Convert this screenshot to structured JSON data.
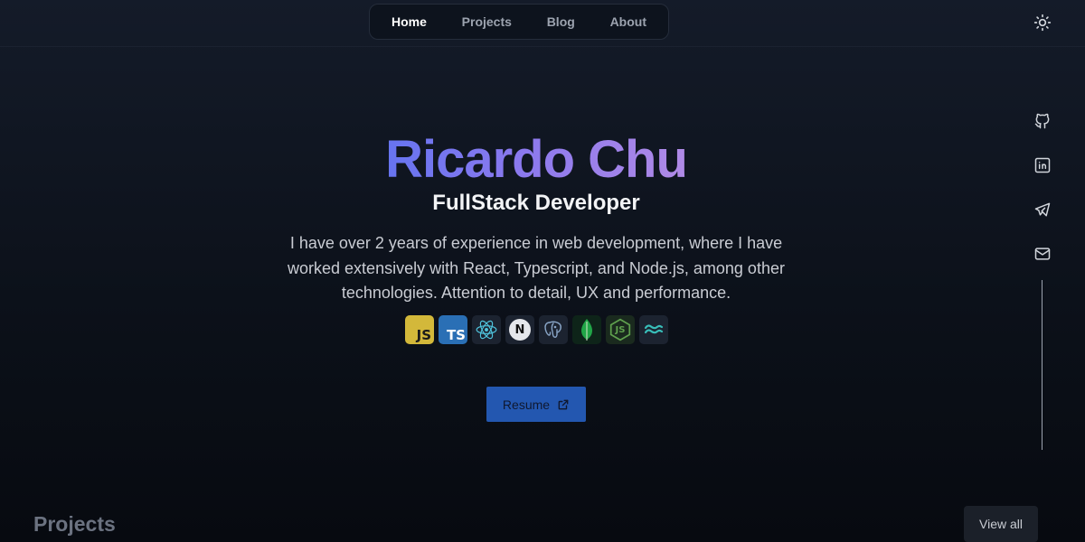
{
  "header": {
    "nav": [
      {
        "label": "Home",
        "active": true
      },
      {
        "label": "Projects",
        "active": false
      },
      {
        "label": "Blog",
        "active": false
      },
      {
        "label": "About",
        "active": false
      }
    ],
    "theme_toggle_icon": "sun-icon"
  },
  "social": [
    {
      "icon": "github-icon"
    },
    {
      "icon": "linkedin-icon"
    },
    {
      "icon": "telegram-icon"
    },
    {
      "icon": "mail-icon"
    }
  ],
  "hero": {
    "name": "Ricardo Chu",
    "role": "FullStack Developer",
    "bio": "I have over 2 years of experience in web development, where I have worked extensively with React, Typescript, and Node.js, among other technologies. Attention to detail, UX and performance.",
    "tech": [
      {
        "icon": "javascript-icon",
        "text": "JS"
      },
      {
        "icon": "typescript-icon",
        "text": "TS"
      },
      {
        "icon": "react-icon"
      },
      {
        "icon": "nextjs-icon",
        "text": "N"
      },
      {
        "icon": "postgresql-icon"
      },
      {
        "icon": "mongodb-icon"
      },
      {
        "icon": "nodejs-icon",
        "text": "JS"
      },
      {
        "icon": "tailwind-icon"
      }
    ],
    "resume_label": "Resume"
  },
  "projects": {
    "title": "Projects",
    "view_all_label": "View all"
  },
  "colors": {
    "background": "#0c111a",
    "accent_gradient_start": "#6674f0",
    "accent_gradient_end": "#b08ae6",
    "button": "#2357b0"
  }
}
